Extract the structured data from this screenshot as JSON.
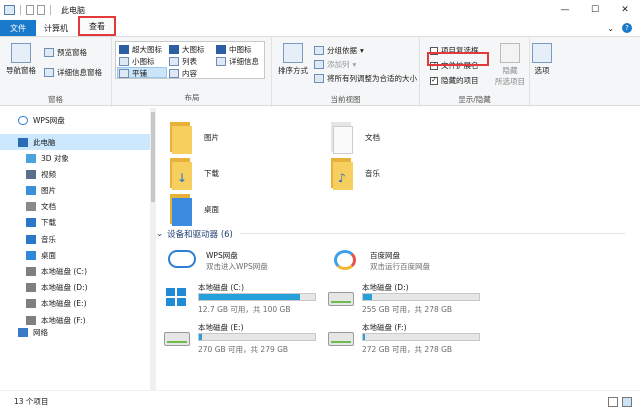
{
  "window": {
    "title": "此电脑"
  },
  "window_buttons": {
    "minimize": "—",
    "maximize": "☐",
    "close": "✕"
  },
  "tabs": {
    "file": "文件",
    "computer": "计算机",
    "view": "查看"
  },
  "ribbon": {
    "pane_group": {
      "nav_pane": "导航窗格",
      "preview_pane": "预览窗格",
      "details_pane": "详细信息窗格",
      "label": "窗格"
    },
    "layout_group": {
      "extra_large": "超大图标",
      "large": "大图标",
      "medium": "中图标",
      "small": "小图标",
      "list": "列表",
      "details": "详细信息",
      "tiles": "平铺",
      "content": "内容",
      "label": "布局"
    },
    "view_group": {
      "sort_by": "排序方式",
      "group_by": "分组依据",
      "add_column": "添加列",
      "size_all": "将所有列调整为合适的大小",
      "label": "当前视图"
    },
    "show_hide_group": {
      "checkboxes": {
        "label": "项目复选框",
        "checked": false
      },
      "extensions": {
        "label": "文件扩展名",
        "checked": true
      },
      "hidden": {
        "label": "隐藏的项目",
        "checked": true
      },
      "hide_selected": "隐藏",
      "hide_selected_2": "所选项目",
      "label": "显示/隐藏"
    },
    "options": "选项"
  },
  "nav": {
    "wps": "WPS网盘",
    "this_pc": "此电脑",
    "items": [
      "3D 对象",
      "视频",
      "图片",
      "文档",
      "下载",
      "音乐",
      "桌面",
      "本地磁盘 (C:)",
      "本地磁盘 (D:)",
      "本地磁盘 (E:)",
      "本地磁盘 (F:)"
    ],
    "network": "网络"
  },
  "folders": {
    "pictures": "图片",
    "documents": "文档",
    "downloads": "下载",
    "music": "音乐",
    "desktop": "桌面"
  },
  "section": {
    "title": "设备和驱动器 (6)"
  },
  "clouds": [
    {
      "name": "WPS网盘",
      "sub": "双击进入WPS网盘"
    },
    {
      "name": "百度网盘",
      "sub": "双击运行百度网盘"
    }
  ],
  "drives": [
    {
      "name": "本地磁盘 (C:)",
      "free": "12.7 GB 可用，共 100 GB",
      "used_fraction": 0.87
    },
    {
      "name": "本地磁盘 (D:)",
      "free": "255 GB 可用，共 278 GB",
      "used_fraction": 0.08
    },
    {
      "name": "本地磁盘 (E:)",
      "free": "270 GB 可用，共 279 GB",
      "used_fraction": 0.03
    },
    {
      "name": "本地磁盘 (F:)",
      "free": "272 GB 可用，共 278 GB",
      "used_fraction": 0.02
    }
  ],
  "status": {
    "count": "13 个项目"
  },
  "colors": {
    "accent": "#1979ca",
    "highlight": "#e03a3a",
    "drive_bar": "#26a0da"
  }
}
